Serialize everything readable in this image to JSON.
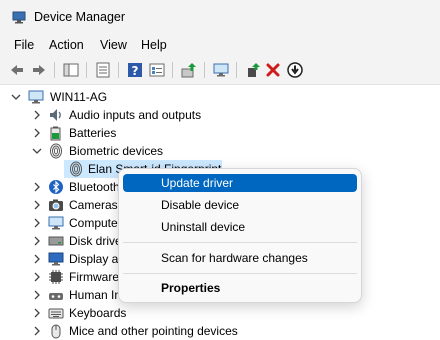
{
  "window": {
    "title": "Device Manager"
  },
  "menu": [
    "File",
    "Action",
    "View",
    "Help"
  ],
  "toolbar": {
    "buttons": [
      "back-icon",
      "forward-icon",
      "properties-pane-icon",
      "show-hidden-icon",
      "help-icon",
      "device-view-icon",
      "update-driver-icon",
      "scan-hardware-icon",
      "enable-device-icon",
      "uninstall-icon",
      "disable-device-icon"
    ]
  },
  "tree": {
    "root": "WIN11-AG",
    "nodes": [
      "Audio inputs and outputs",
      "Batteries",
      "Biometric devices",
      "Elan Smart-id Fingerprint",
      "Bluetooth",
      "Cameras",
      "Computer",
      "Disk drives",
      "Display adapters",
      "Firmware",
      "Human Interface Devices",
      "Keyboards",
      "Mice and other pointing devices"
    ]
  },
  "context_menu": {
    "items": [
      "Update driver",
      "Disable device",
      "Uninstall device",
      "Scan for hardware changes",
      "Properties"
    ],
    "highlighted": "Update driver"
  },
  "colors": {
    "accent": "#0067c0",
    "selection": "#cce8ff",
    "delete_red": "#d11a1a",
    "green": "#1a9a3a"
  }
}
